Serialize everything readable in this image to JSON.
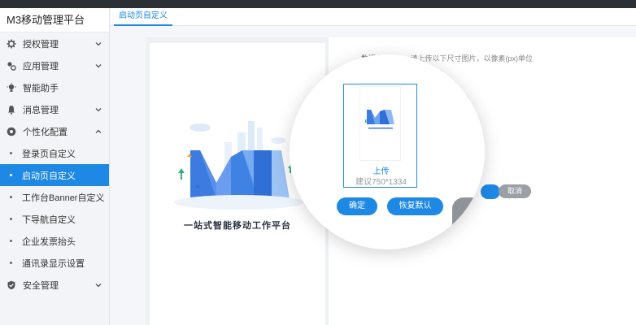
{
  "app": {
    "title": "M3移动管理平台"
  },
  "sidebar": {
    "items": [
      {
        "label": "授权管理",
        "icon": "gear-icon"
      },
      {
        "label": "应用管理",
        "icon": "apps-icon"
      },
      {
        "label": "智能助手",
        "icon": "bulb-icon"
      },
      {
        "label": "消息管理",
        "icon": "bell-icon"
      },
      {
        "label": "个性化配置",
        "icon": "palette-icon"
      }
    ],
    "sub_items": [
      {
        "label": "登录页自定义"
      },
      {
        "label": "启动页自定义"
      },
      {
        "label": "工作台Banner自定义"
      },
      {
        "label": "下导航自定义"
      },
      {
        "label": "企业发票抬头"
      },
      {
        "label": "通讯录显示设置"
      }
    ],
    "last_item": {
      "label": "安全管理",
      "icon": "shield-icon"
    },
    "active_sub": "启动页自定义"
  },
  "tabs": [
    {
      "label": "启动页自定义"
    }
  ],
  "preview": {
    "slogan": "一站式智能移动工作平台"
  },
  "config": {
    "description_lead": "数据类型",
    "description": "请上传以下尺寸图片，以像素(px)单位",
    "cancel_label": "取消"
  },
  "upload": {
    "label": "上传",
    "hint": "建议750*1334"
  },
  "buttons": {
    "confirm": "确定",
    "reset": "恢复默认"
  },
  "colors": {
    "primary": "#1e88e5",
    "sidebar_bg": "#f2f4f7",
    "gray_button": "#9aa0a6"
  }
}
